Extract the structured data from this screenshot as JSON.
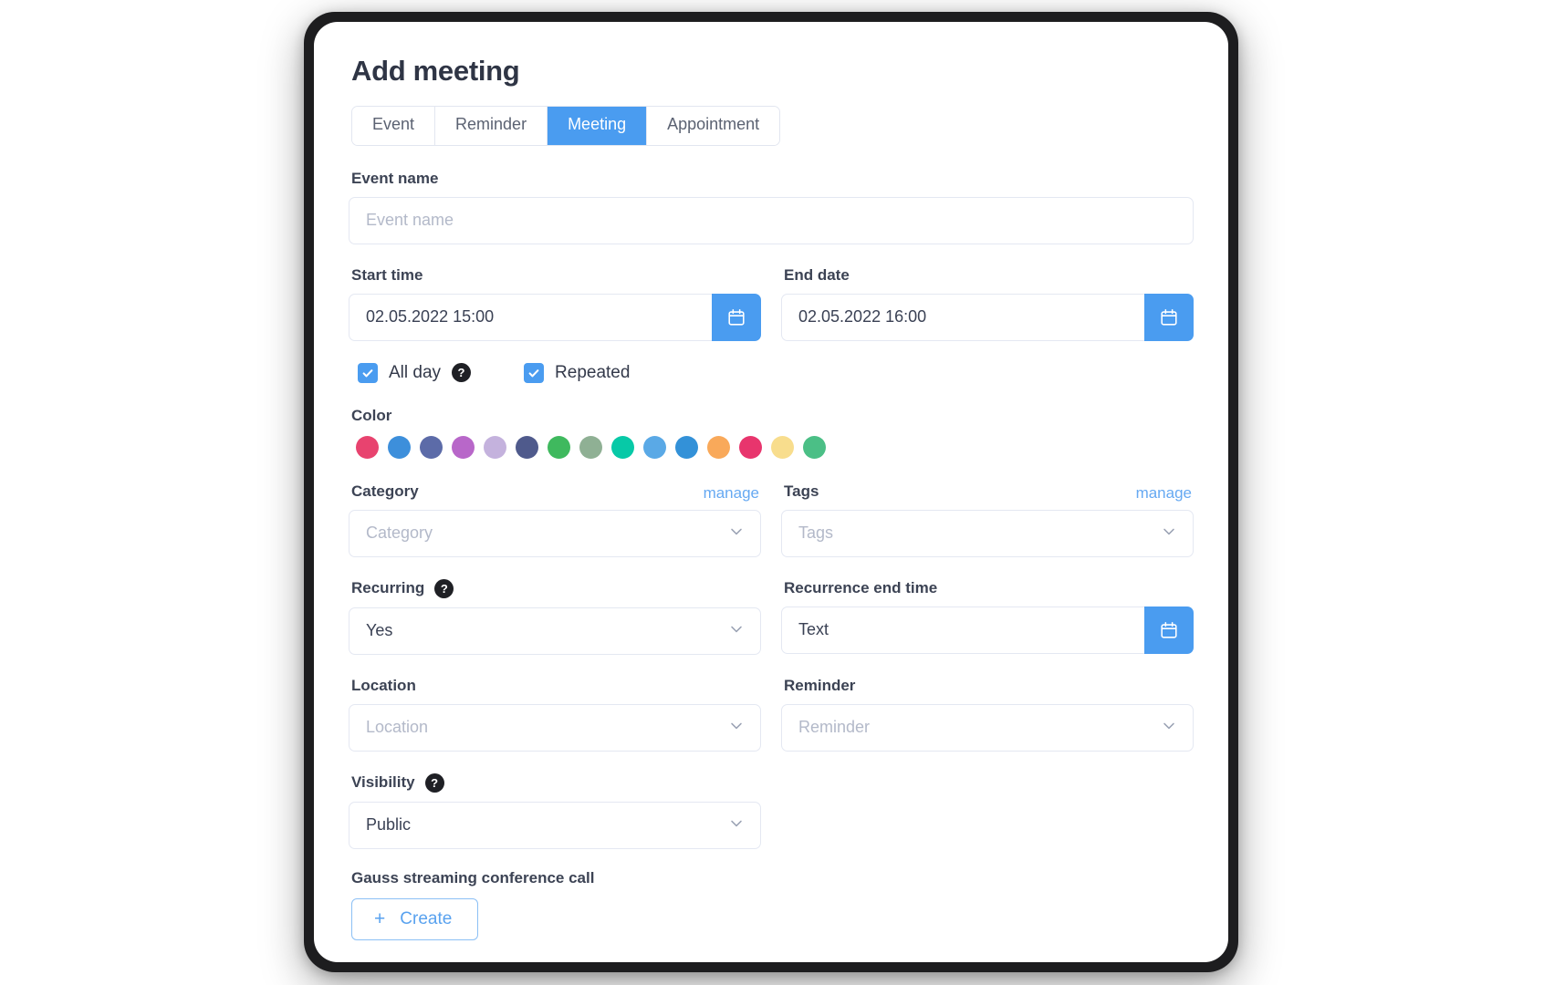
{
  "dialog": {
    "title": "Add meeting"
  },
  "tabs": [
    {
      "label": "Event",
      "active": false
    },
    {
      "label": "Reminder",
      "active": false
    },
    {
      "label": "Meeting",
      "active": true
    },
    {
      "label": "Appointment",
      "active": false
    }
  ],
  "event_name": {
    "label": "Event name",
    "value": "",
    "placeholder": "Event name"
  },
  "start_time": {
    "label": "Start time",
    "value": "02.05.2022 15:00",
    "calendar_icon": "calendar-icon"
  },
  "end_date": {
    "label": "End date",
    "value": "02.05.2022 16:00",
    "calendar_icon": "calendar-icon"
  },
  "checkboxes": [
    {
      "label": "All day",
      "checked": true,
      "help": "?"
    },
    {
      "label": "Repeated",
      "checked": true
    }
  ],
  "color": {
    "label": "Color",
    "swatches": [
      "#e8436f",
      "#3d8fdb",
      "#5c6ba8",
      "#b867c9",
      "#c4b2dd",
      "#4f5a8c",
      "#3fb95e",
      "#8fb094",
      "#07c9a7",
      "#5aa9e6",
      "#3391d8",
      "#f9a95a",
      "#e8356d",
      "#f8dd8d",
      "#4bbf86"
    ]
  },
  "category": {
    "label": "Category",
    "manage_label": "manage",
    "value": "",
    "placeholder": "Category"
  },
  "tags": {
    "label": "Tags",
    "manage_label": "manage",
    "value": "",
    "placeholder": "Tags"
  },
  "recurring": {
    "label": "Recurring",
    "help": "?",
    "value": "Yes"
  },
  "recurrence_end_time": {
    "label": "Recurrence end time",
    "value": "Text",
    "calendar_icon": "calendar-icon"
  },
  "location": {
    "label": "Location",
    "value": "",
    "placeholder": "Location"
  },
  "reminder": {
    "label": "Reminder",
    "value": "",
    "placeholder": "Reminder"
  },
  "visibility": {
    "label": "Visibility",
    "help": "?",
    "value": "Public"
  },
  "conference": {
    "label": "Gauss streaming conference call",
    "create_label": "Create",
    "plus_icon": "+"
  }
}
